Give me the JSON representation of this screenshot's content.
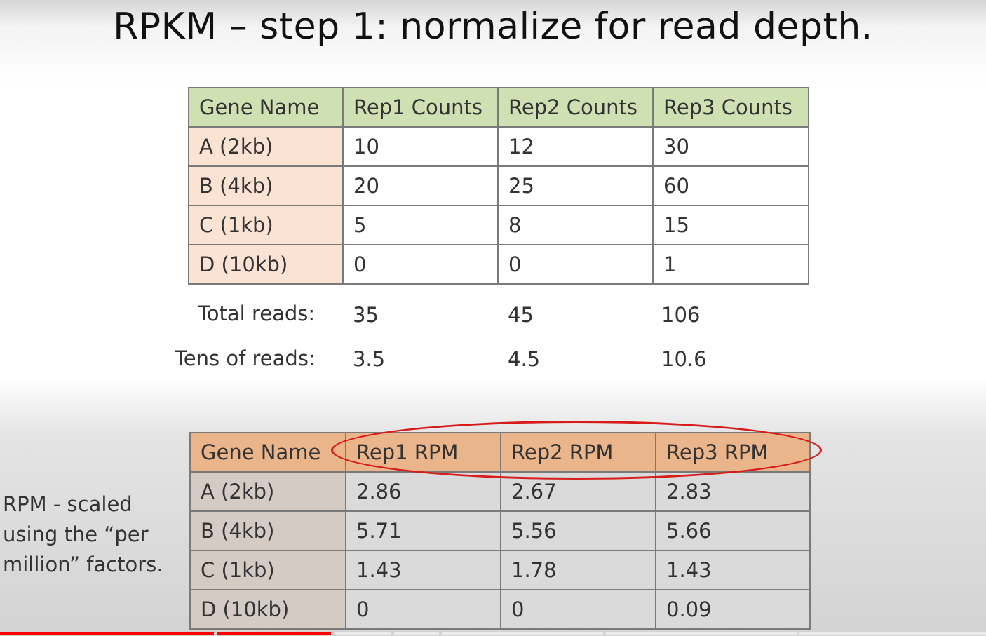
{
  "slide": {
    "title": "RPKM – step 1: normalize for read depth."
  },
  "counts_table": {
    "headers": [
      "Gene Name",
      "Rep1 Counts",
      "Rep2 Counts",
      "Rep3 Counts"
    ],
    "rows": [
      [
        "A (2kb)",
        "10",
        "12",
        "30"
      ],
      [
        "B (4kb)",
        "20",
        "25",
        "60"
      ],
      [
        "C (1kb)",
        "5",
        "8",
        "15"
      ],
      [
        "D (10kb)",
        "0",
        "0",
        "1"
      ]
    ]
  },
  "totals": {
    "total_label": "Total reads:",
    "total_values": [
      "35",
      "45",
      "106"
    ],
    "tens_label": "Tens of reads:",
    "tens_values": [
      "3.5",
      "4.5",
      "10.6"
    ]
  },
  "rpm_table": {
    "headers": [
      "Gene Name",
      "Rep1 RPM",
      "Rep2 RPM",
      "Rep3 RPM"
    ],
    "rows": [
      [
        "A (2kb)",
        "2.86",
        "2.67",
        "2.83"
      ],
      [
        "B (4kb)",
        "5.71",
        "5.56",
        "5.66"
      ],
      [
        "C (1kb)",
        "1.43",
        "1.78",
        "1.43"
      ],
      [
        "D (10kb)",
        "0",
        "0",
        "0.09"
      ]
    ]
  },
  "side_note": {
    "lines": [
      "RPM - scaled",
      "using the “per",
      "million” factors."
    ]
  },
  "video": {
    "progress_fraction": 0.336,
    "progress_color": "#ff0000"
  }
}
